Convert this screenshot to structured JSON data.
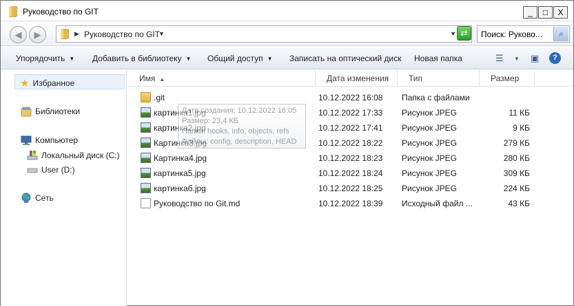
{
  "window": {
    "title": "Руководство по GIT",
    "controls": {
      "minimize": "_",
      "maximize": "□",
      "close": "X"
    }
  },
  "address_bar": {
    "path": "Руководство по GIT",
    "search_placeholder": "Поиск: Руково...",
    "icons": [
      "back-icon",
      "forward-icon",
      "folder-icon",
      "refresh-icon",
      "search-icon"
    ]
  },
  "toolbar": {
    "organize": "Упорядочить",
    "add_to_library": "Добавить в библиотеку",
    "share": "Общий доступ",
    "burn": "Записать на оптический диск",
    "new_folder": "Новая папка"
  },
  "nav_pane": {
    "favorites": "Избранное",
    "libraries": "Библиотеки",
    "computer": "Компьютер",
    "local_disk": "Локальный диск (C:)",
    "user_disk": "User (D:)",
    "network": "Сеть"
  },
  "columns": {
    "name": "Имя",
    "date": "Дата изменения",
    "type": "Тип",
    "size": "Размер"
  },
  "files": [
    {
      "name": ".git",
      "date": "10.12.2022 16:08",
      "type": "Папка с файлами",
      "size": "",
      "icon": "folder-icon"
    },
    {
      "name": "картинка1.jpg",
      "date": "10.12.2022 17:33",
      "type": "Рисунок JPEG",
      "size": "11 КБ",
      "icon": "image-icon"
    },
    {
      "name": "картинка2.jpg",
      "date": "10.12.2022 17:41",
      "type": "Рисунок JPEG",
      "size": "9 КБ",
      "icon": "image-icon"
    },
    {
      "name": "Картинка3.jpg",
      "date": "10.12.2022 18:22",
      "type": "Рисунок JPEG",
      "size": "279 КБ",
      "icon": "image-icon"
    },
    {
      "name": "Картинка4.jpg",
      "date": "10.12.2022 18:23",
      "type": "Рисунок JPEG",
      "size": "280 КБ",
      "icon": "image-icon"
    },
    {
      "name": "картинка5.jpg",
      "date": "10.12.2022 18:24",
      "type": "Рисунок JPEG",
      "size": "309 КБ",
      "icon": "image-icon"
    },
    {
      "name": "картинкаб.jpg",
      "date": "10.12.2022 18:25",
      "type": "Рисунок JPEG",
      "size": "224 КБ",
      "icon": "image-icon"
    },
    {
      "name": "Руководство по Git.md",
      "date": "10.12.2022 18:39",
      "type": "Исходный файл ...",
      "size": "43 КБ",
      "icon": "document-icon"
    }
  ],
  "tooltip": {
    "line1": "Дата создания: 10.12.2022 16:05",
    "line2": "Размер: 23,4 КБ",
    "line3": "Папки: hooks, info, objects, refs",
    "line4": "Файлы: config, description, HEAD"
  }
}
